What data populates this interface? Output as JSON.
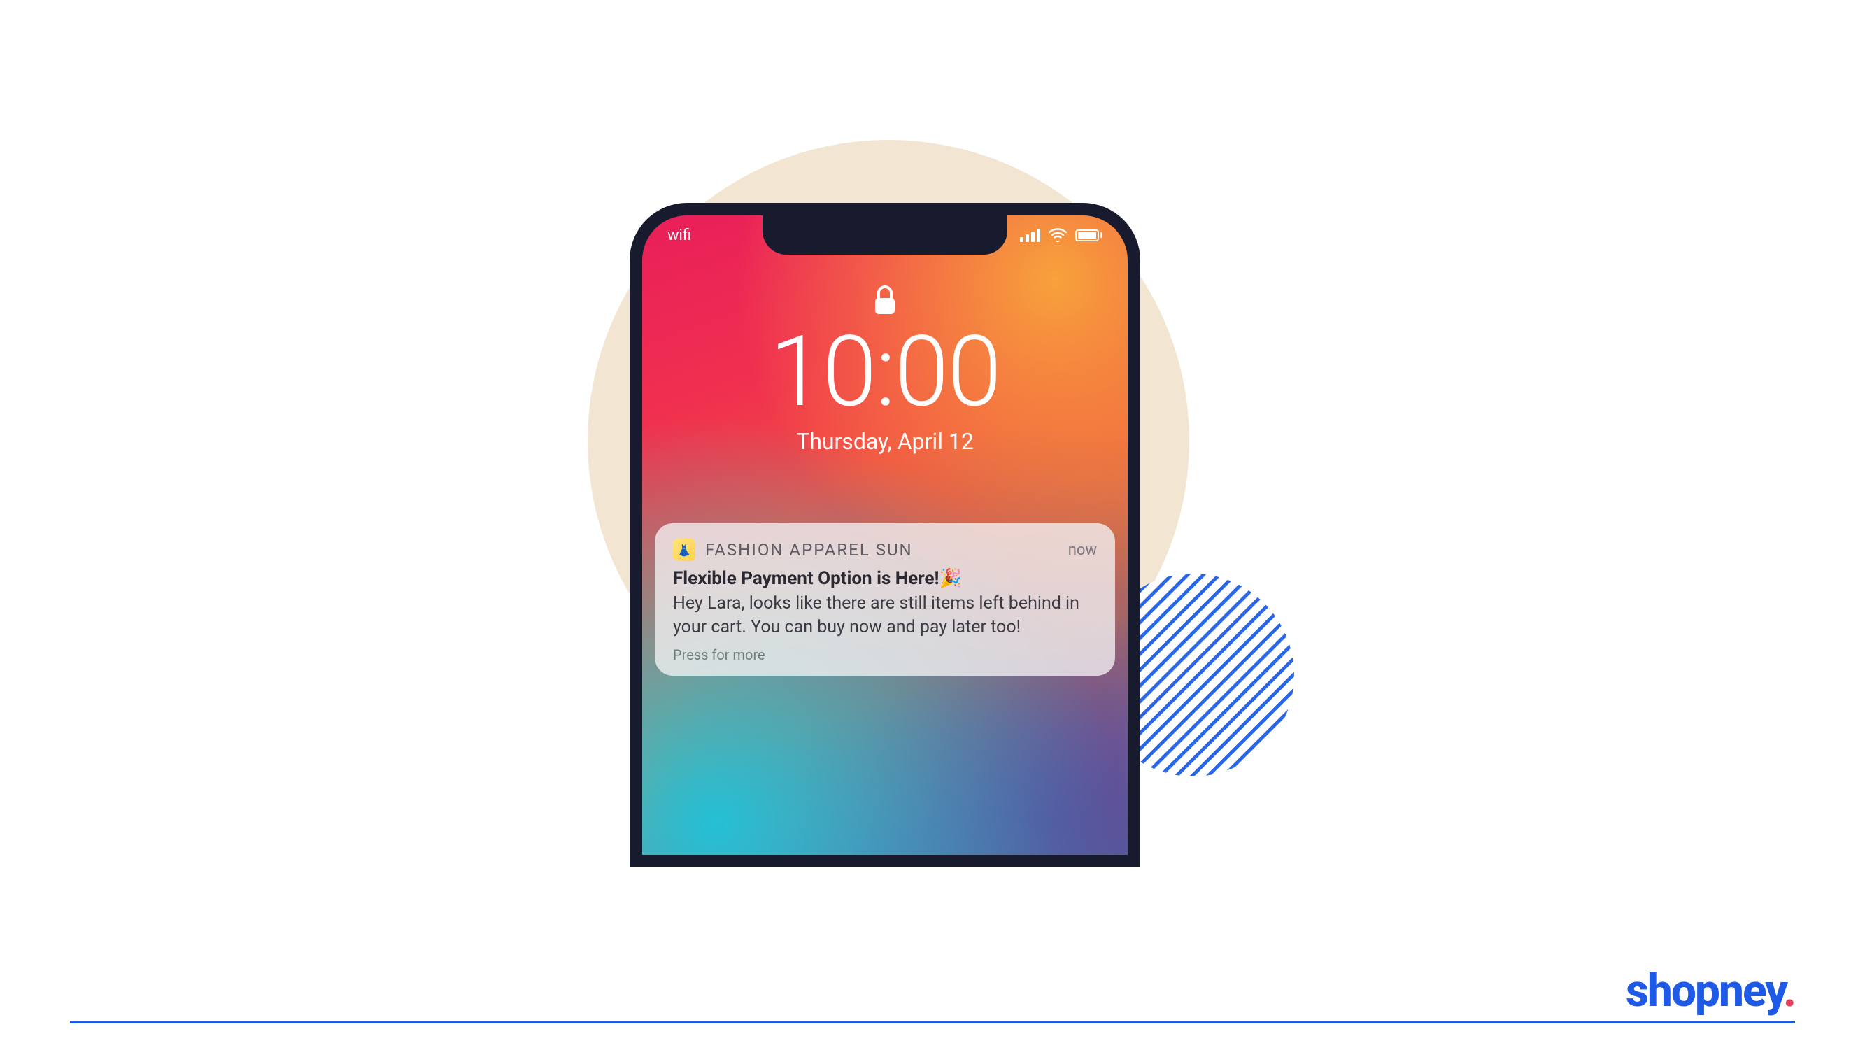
{
  "status_bar": {
    "left_label": "wifi"
  },
  "lockscreen": {
    "time": "10:00",
    "date": "Thursday, April 12"
  },
  "notification": {
    "app_name": "FASHION APPAREL SUN",
    "timestamp": "now",
    "title": "Flexible Payment Option is Here!🎉",
    "body": "Hey Lara, looks like there are still items left behind in your cart. You can buy now and pay later too!",
    "more_label": "Press for more"
  },
  "brand": {
    "name": "shopney",
    "punct": "."
  },
  "colors": {
    "accent_blue": "#1E5AE6",
    "accent_pink": "#E63E5B",
    "bg_circle": "#F2E5D2"
  }
}
